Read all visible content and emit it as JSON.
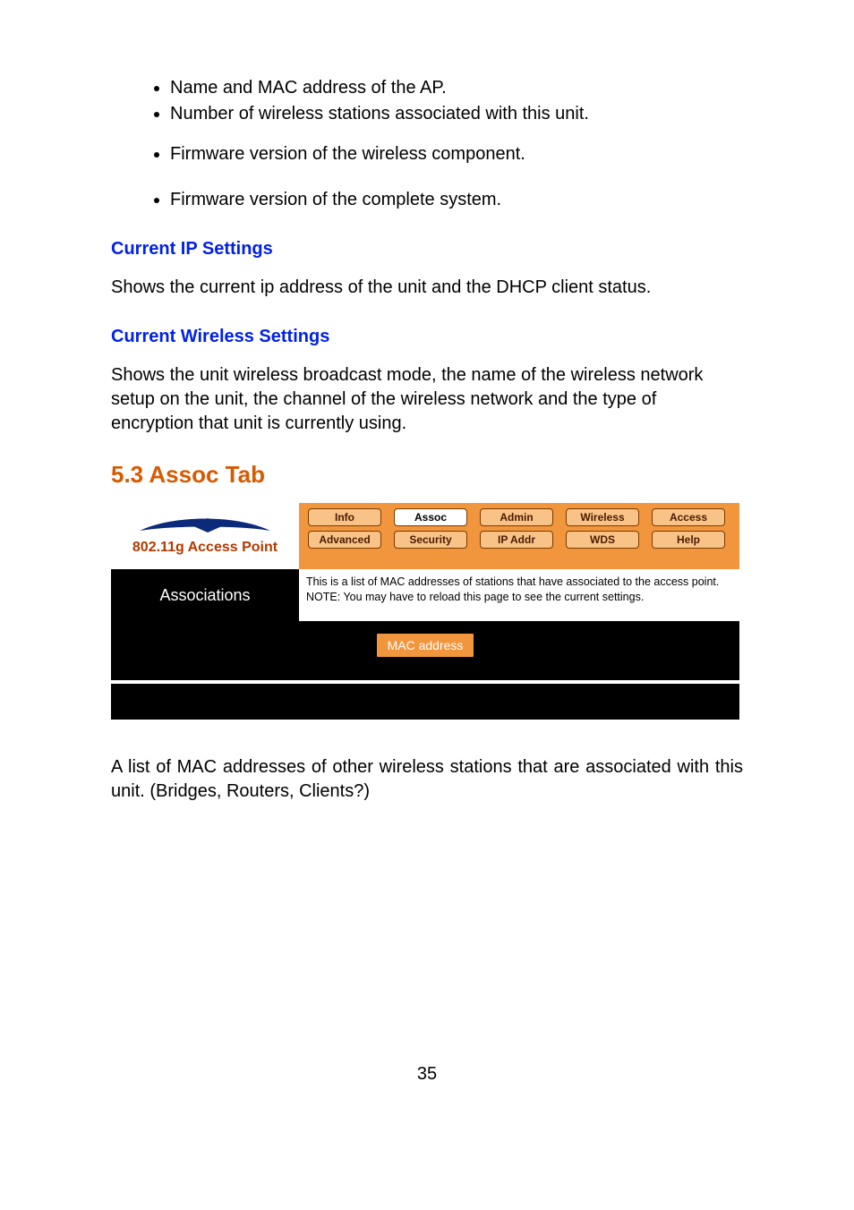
{
  "bullets_group1": [
    "Name and MAC address of the AP.",
    "Number of wireless stations associated with this unit."
  ],
  "bullets_group2": [
    "Firmware version of the wireless component."
  ],
  "bullets_group3": [
    "Firmware version of the complete system."
  ],
  "heading_ip": "Current IP Settings",
  "para_ip": "Shows the current ip address of the unit and the DHCP client status.",
  "heading_wireless": "Current Wireless Settings",
  "para_wireless": "Shows the unit wireless broadcast mode, the name of the wireless network setup on the unit, the channel of the wireless network and the type of encryption that unit is currently using.",
  "section_heading": "5.3 Assoc Tab",
  "figure": {
    "brand": "802.11g Access Point",
    "tabs_row1": [
      "Info",
      "Assoc",
      "Admin",
      "Wireless",
      "Access"
    ],
    "tabs_row2": [
      "Advanced",
      "Security",
      "IP Addr",
      "WDS",
      "Help"
    ],
    "selected_tab": "Assoc",
    "side_title": "Associations",
    "description": "This is a list of MAC addresses of stations that have associated to the access point. NOTE: You may have to reload this page to see the current settings.",
    "mac_header": "MAC address"
  },
  "para_below": "A list of MAC addresses of other wireless stations that are associated with this unit. (Bridges, Routers, Clients?)",
  "page_number": "35"
}
